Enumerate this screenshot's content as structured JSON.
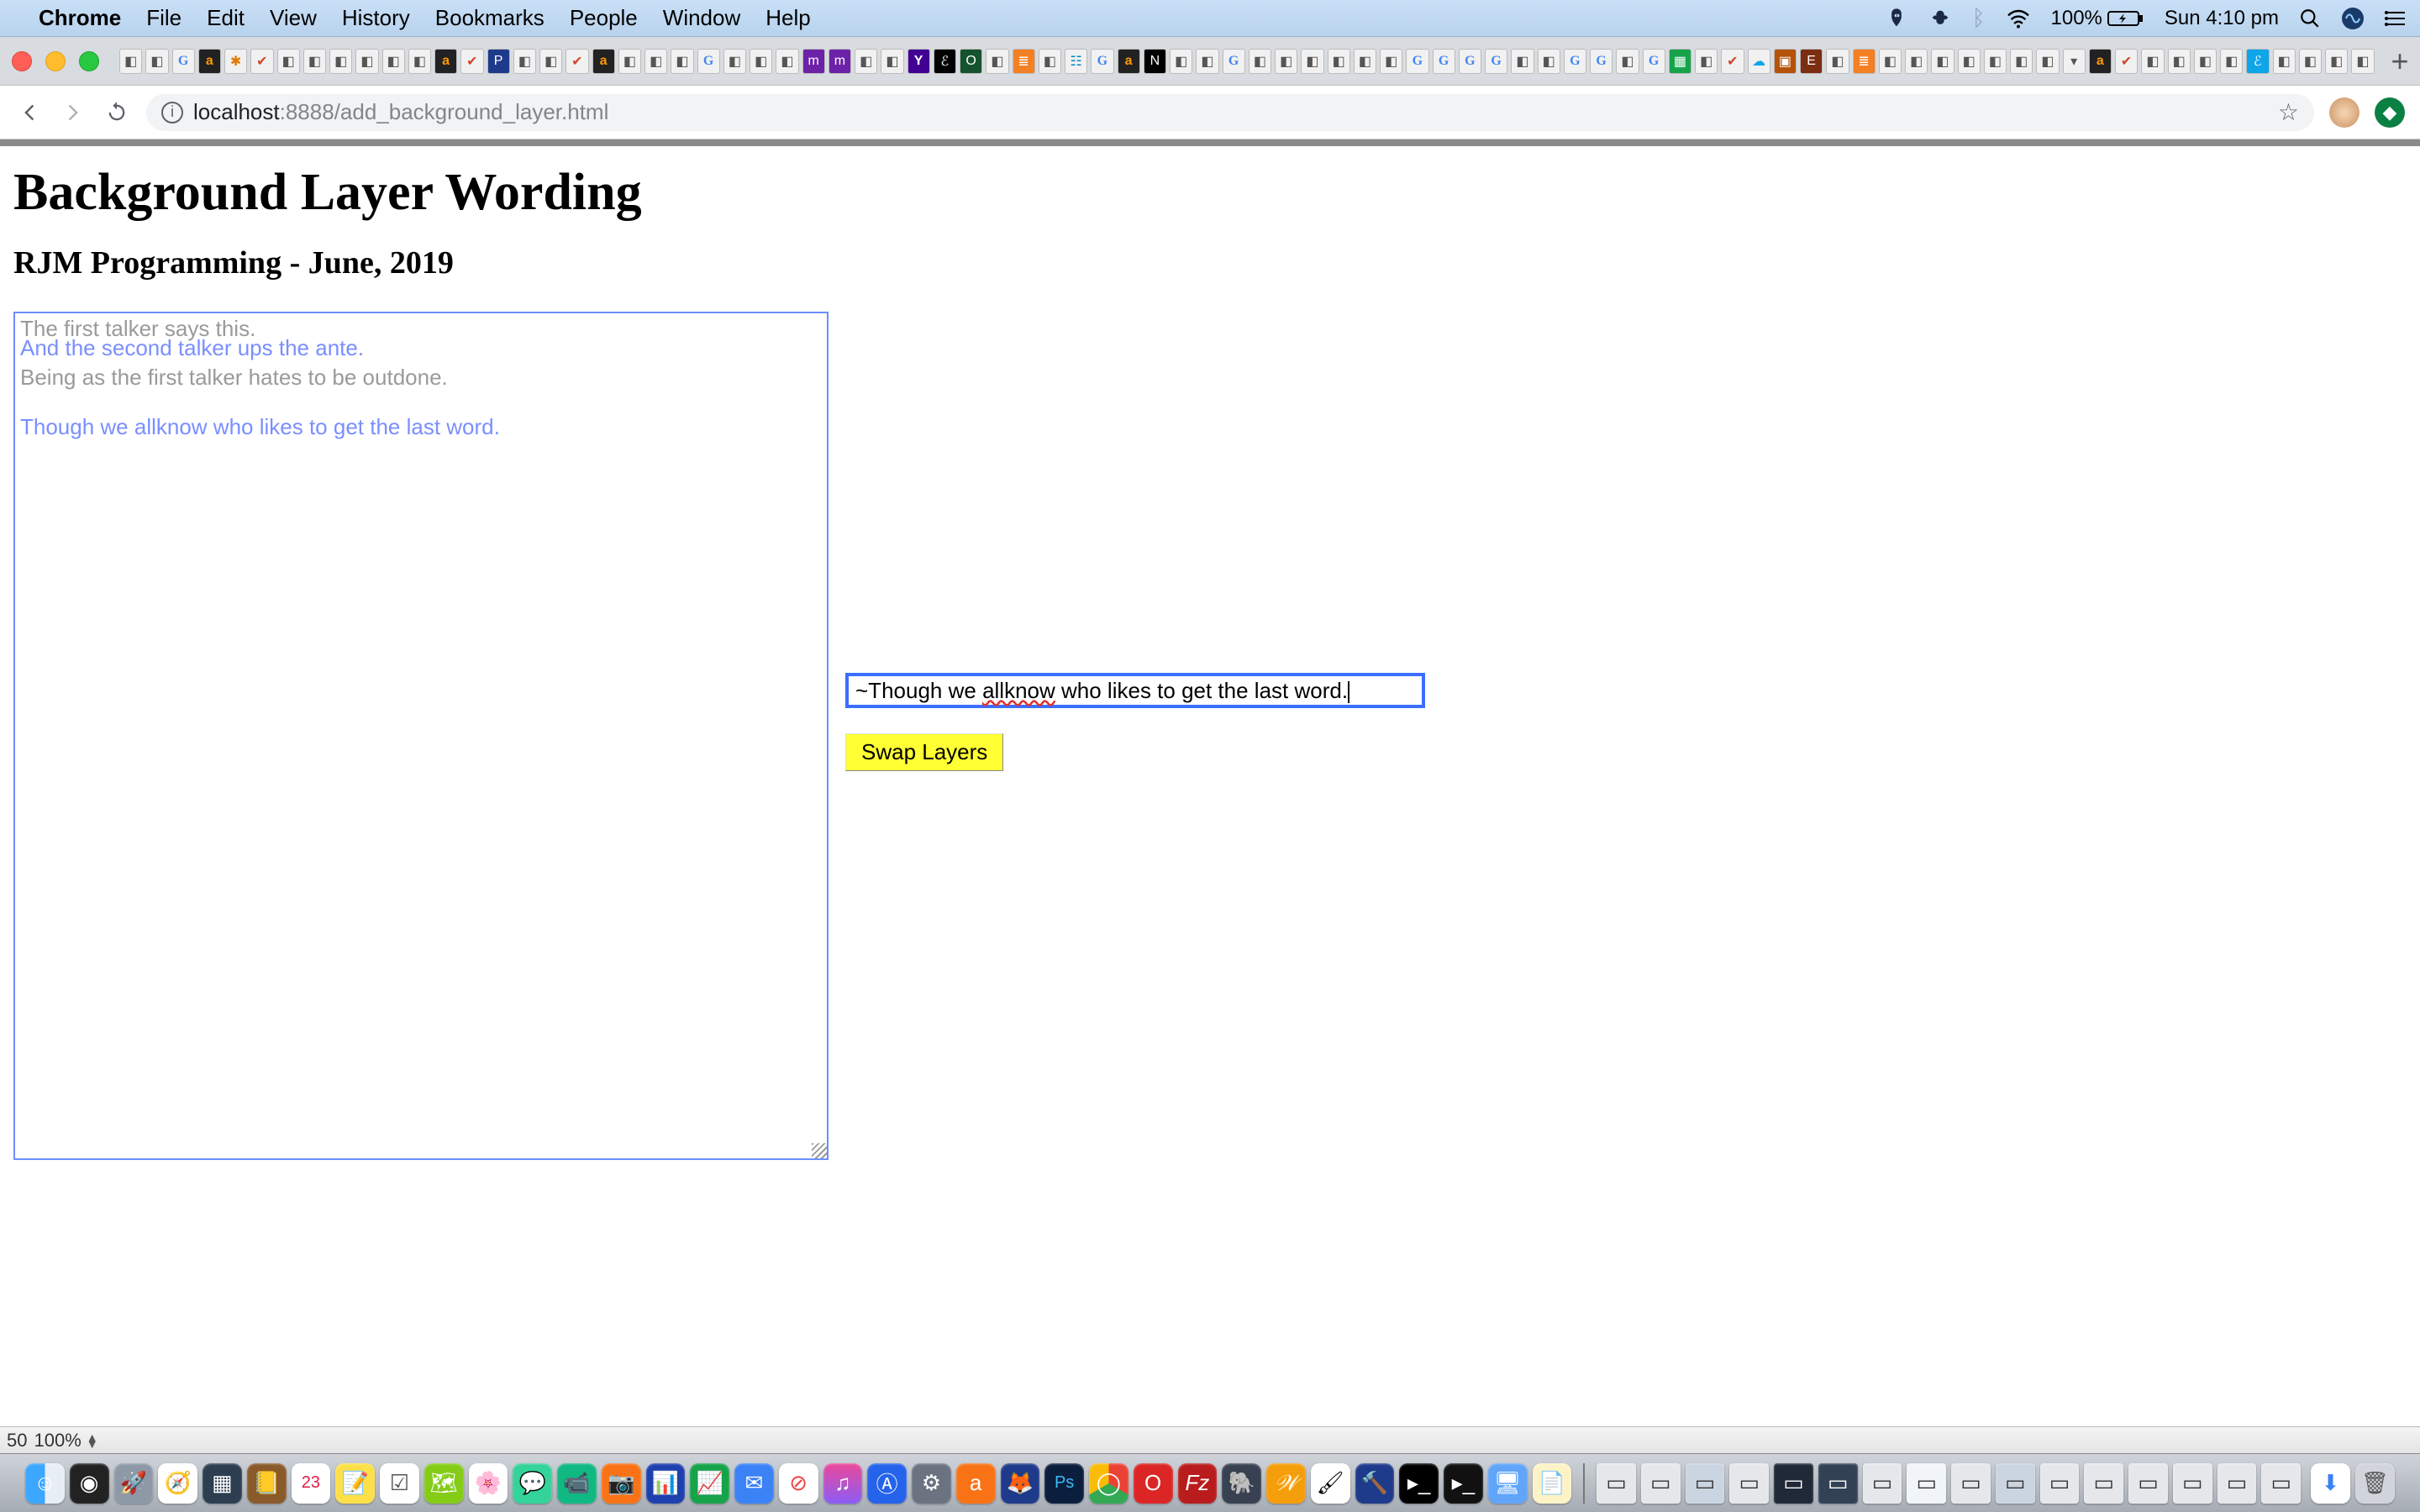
{
  "menubar": {
    "app": "Chrome",
    "items": [
      "File",
      "Edit",
      "View",
      "History",
      "Bookmarks",
      "People",
      "Window",
      "Help"
    ],
    "battery": "100%",
    "clock": "Sun 4:10 pm"
  },
  "addrbar": {
    "host": "localhost",
    "port": ":8888",
    "path": "/add_background_layer.html"
  },
  "page": {
    "title": "Background Layer Wording",
    "subtitle": "RJM Programming - June, 2019",
    "layer_lines": {
      "l1": "The first talker says this.",
      "l2": "And the second talker ups the ante.",
      "l3": "Being as the first talker hates to be outdone.",
      "l4": "Though we allknow who likes to get the last word."
    },
    "input_prefix": "~Though we ",
    "input_spell": "allknow",
    "input_suffix": " who likes to get the last word.",
    "swap_label": "Swap Layers"
  },
  "status": {
    "left": "50",
    "zoom": "100%"
  }
}
